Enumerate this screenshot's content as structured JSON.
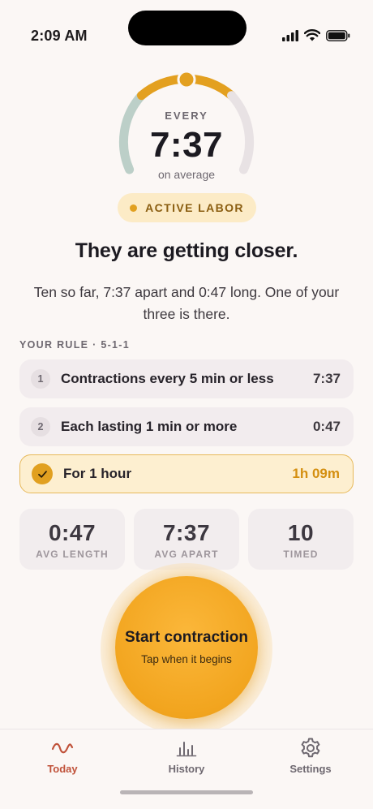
{
  "status_bar": {
    "time": "2:09 AM"
  },
  "gauge": {
    "label_top": "EVERY",
    "value": "7:37",
    "label_bottom": "on average"
  },
  "phase_badge": {
    "label": "ACTIVE LABOR"
  },
  "headline": "They are getting closer.",
  "summary": "Ten so far, 7:37 apart and 0:47 long. One of your three is there.",
  "rule": {
    "heading": "YOUR RULE · 5-1-1",
    "items": [
      {
        "num": "1",
        "label": "Contractions every 5 min or less",
        "value": "7:37",
        "met": false
      },
      {
        "num": "2",
        "label": "Each lasting 1 min or more",
        "value": "0:47",
        "met": false
      },
      {
        "num": "",
        "label": "For 1 hour",
        "value": "1h 09m",
        "met": true
      }
    ]
  },
  "stats": [
    {
      "value": "0:47",
      "label": "AVG LENGTH"
    },
    {
      "value": "7:37",
      "label": "AVG APART"
    },
    {
      "value": "10",
      "label": "TIMED"
    }
  ],
  "start_button": {
    "title": "Start contraction",
    "subtitle": "Tap when it begins"
  },
  "tabs": [
    {
      "label": "Today",
      "icon": "wave-icon",
      "active": true
    },
    {
      "label": "History",
      "icon": "bar-chart-icon",
      "active": false
    },
    {
      "label": "Settings",
      "icon": "gear-icon",
      "active": false
    }
  ],
  "colors": {
    "accent": "#f2a51f",
    "accent_dark": "#e1a020",
    "active_tab": "#c0523a",
    "gauge_green": "#bccfc8",
    "gauge_grey": "#e8e2e4",
    "background": "#fbf7f5"
  }
}
